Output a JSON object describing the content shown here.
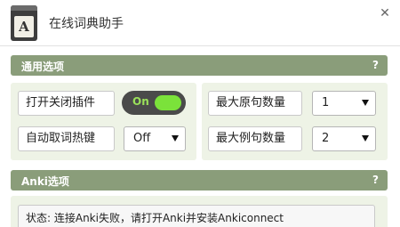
{
  "header": {
    "icon_letter": "A",
    "title": "在线词典助手",
    "close_symbol": "✕"
  },
  "general_section": {
    "title": "通用选项",
    "help": "?",
    "plugin_toggle": {
      "label": "打开关闭插件",
      "state_text": "On"
    },
    "hotkey": {
      "label": "自动取词热键",
      "selected": "Off"
    },
    "max_original": {
      "label": "最大原句数量",
      "selected": "1"
    },
    "max_example": {
      "label": "最大例句数量",
      "selected": "2"
    }
  },
  "anki_section": {
    "title": "Anki选项",
    "help": "?",
    "status_text": "状态: 连接Anki失败，请打开Anki并安装Ankiconnect"
  }
}
